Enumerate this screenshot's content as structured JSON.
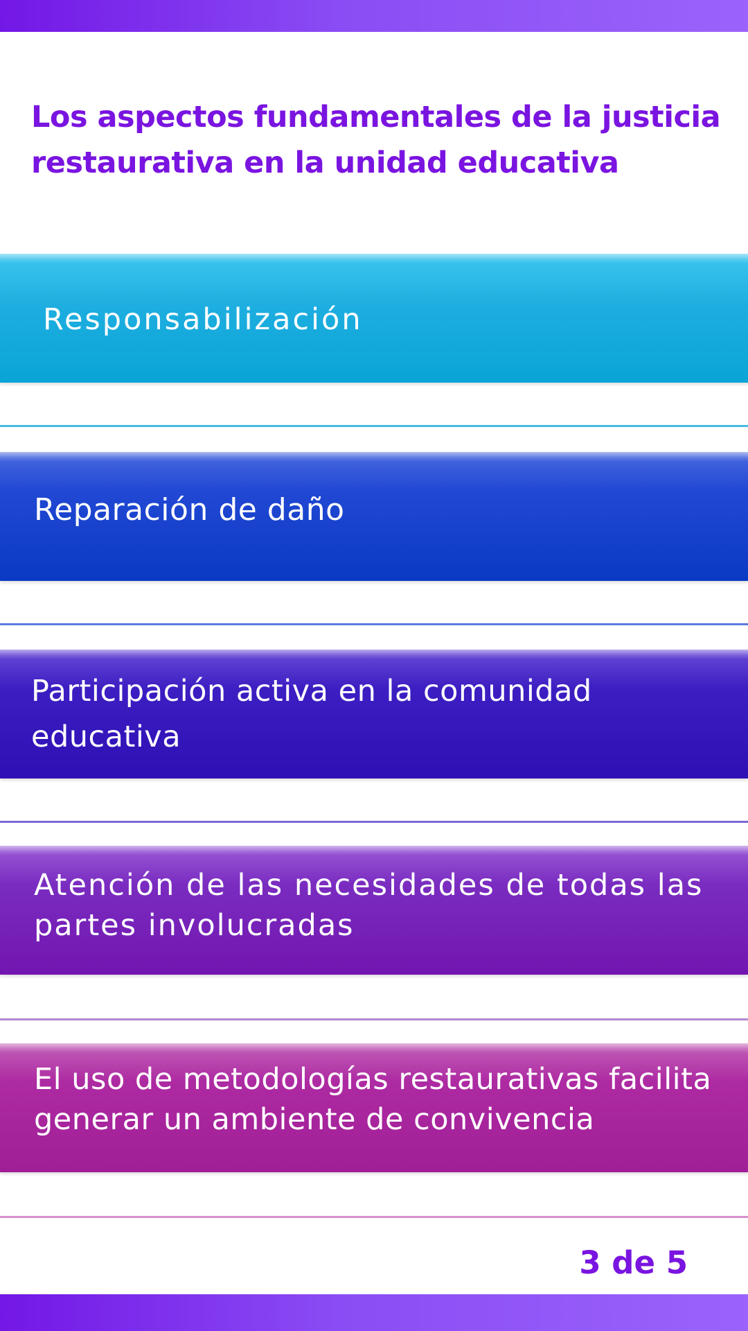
{
  "header": {
    "title": "Los aspectos fundamentales de la justicia restaurativa en la unidad educativa"
  },
  "items": [
    {
      "label": "Responsabilización",
      "color": "#0aa4d6"
    },
    {
      "label": "Reparación de daño",
      "color": "#0a3ac2"
    },
    {
      "label": "Participación activa en la comunidad educativa",
      "color": "#2e0fb4"
    },
    {
      "label": "Atención de las necesidades de todas las partes involucradas",
      "color": "#7216b0"
    },
    {
      "label": "El uso de metodologías restaurativas facilita generar un ambiente de convivencia",
      "color": "#a01e96"
    }
  ],
  "pager": {
    "label": "3 de 5"
  },
  "theme": {
    "accent": "#7a14e0",
    "bar_gradient": [
      "#7317e6",
      "#9b63fb"
    ]
  }
}
